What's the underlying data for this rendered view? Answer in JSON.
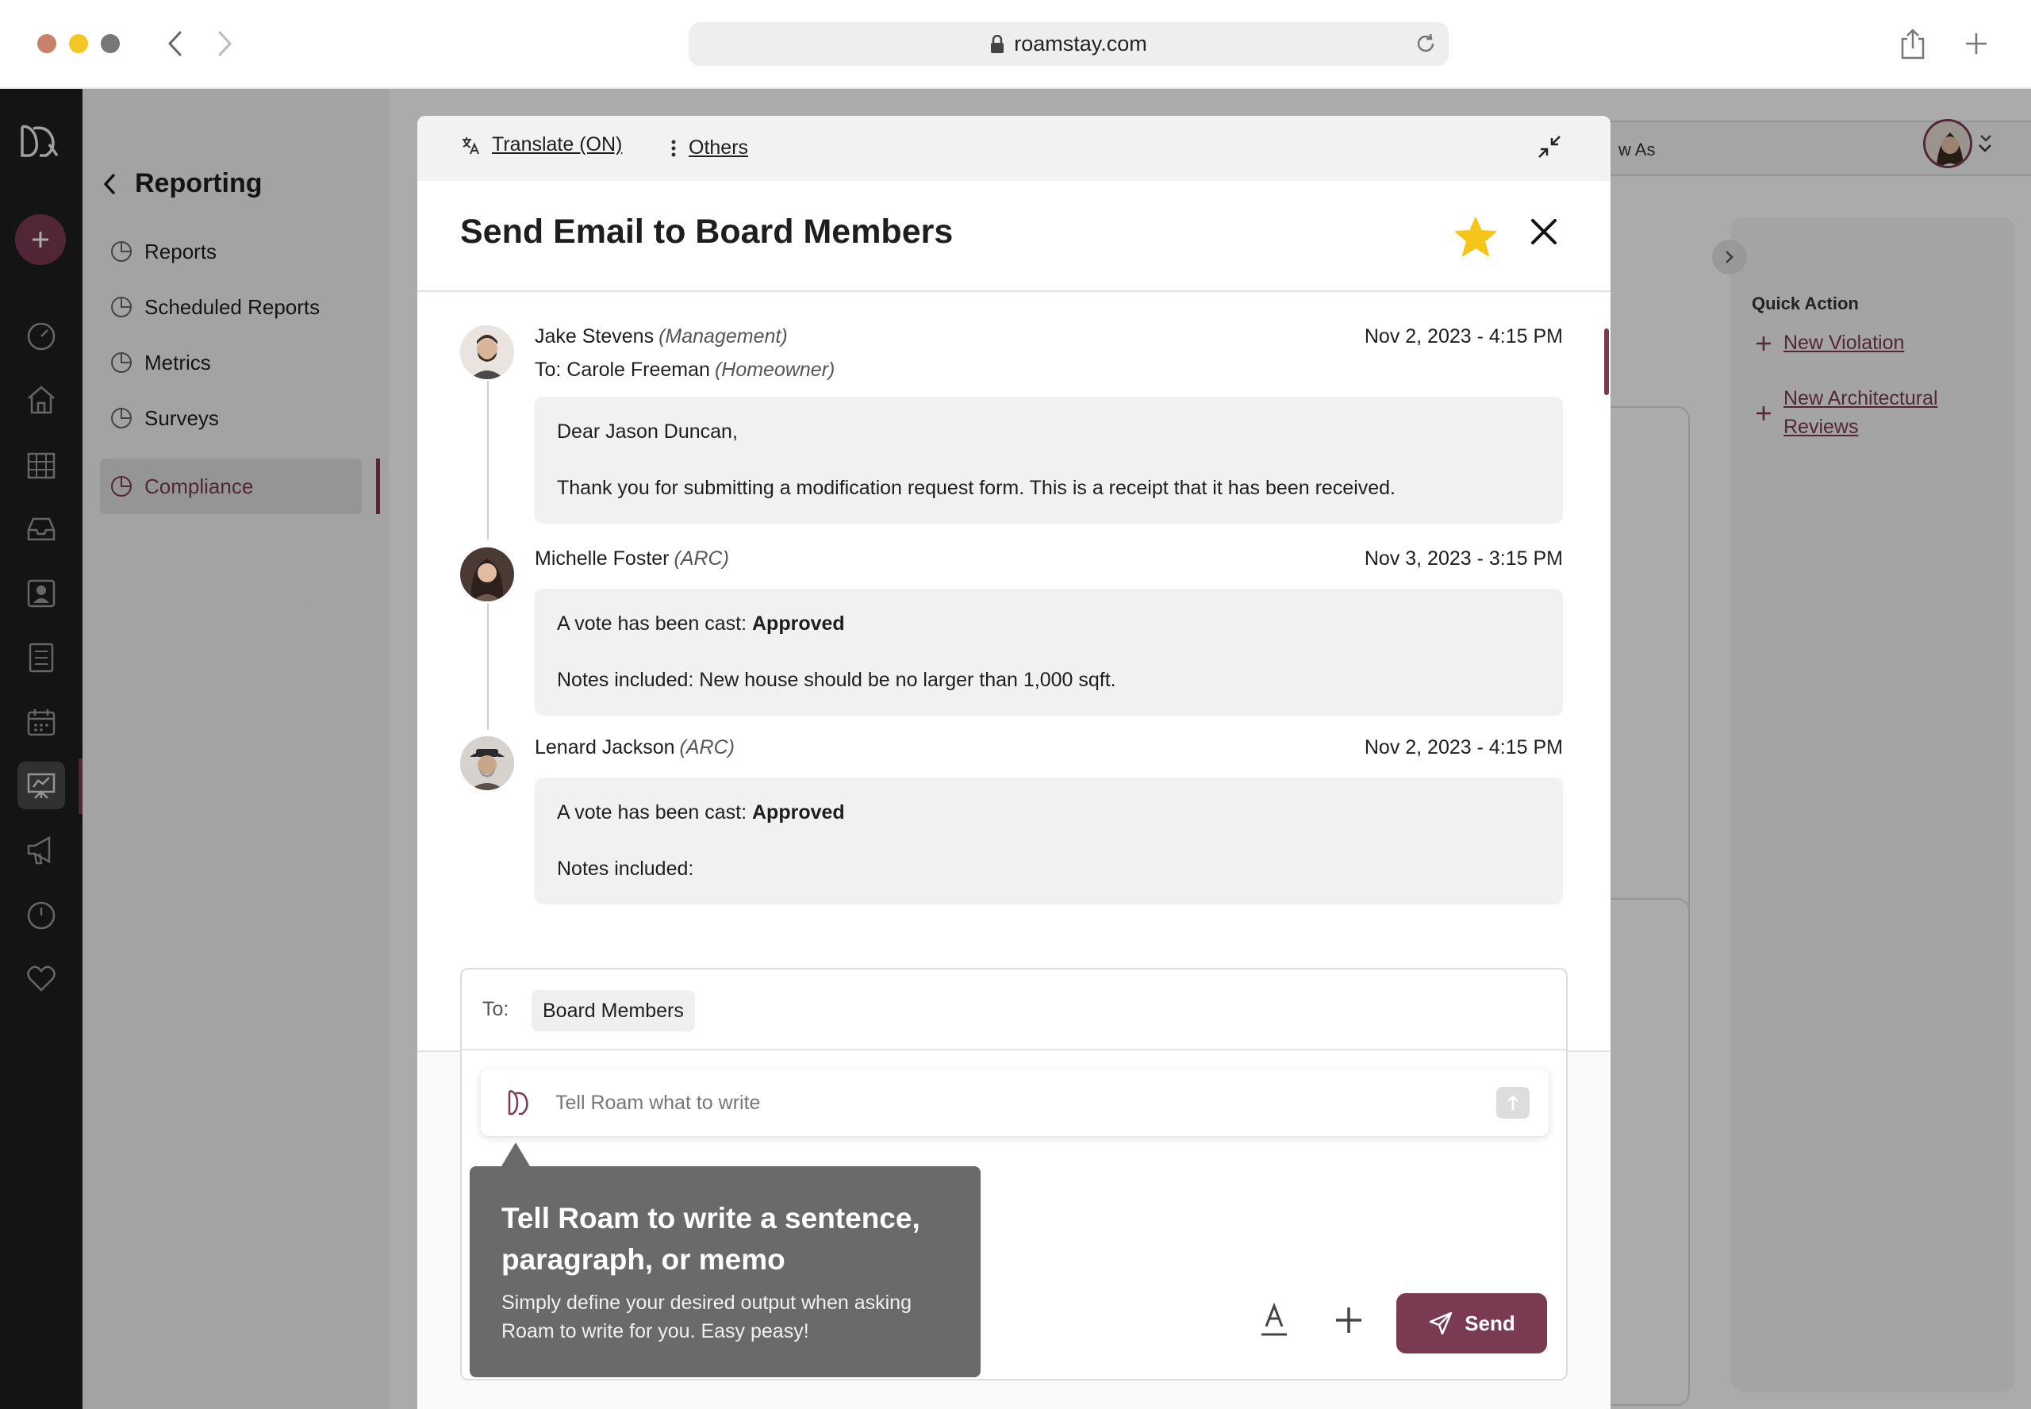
{
  "browser": {
    "url": "roamstay.com"
  },
  "sidebar": {
    "title": "Reporting",
    "items": [
      {
        "label": "Reports"
      },
      {
        "label": "Scheduled Reports"
      },
      {
        "label": "Metrics"
      },
      {
        "label": "Surveys"
      },
      {
        "label": "Compliance"
      }
    ]
  },
  "main": {
    "view_as_text": "w As",
    "quick_action": {
      "title": "Quick Action",
      "links": [
        "New Violation",
        "New Architectural",
        "Reviews"
      ]
    }
  },
  "modal": {
    "toolbar": {
      "translate_label": "Translate (ON)",
      "others_label": "Others"
    },
    "title": "Send Email to Board Members",
    "messages": [
      {
        "name": "Jake Stevens",
        "role": "(Management)",
        "date": "Nov 2, 2023 - 4:15 PM",
        "to_prefix": "To: Carole Freeman",
        "to_role": "(Homeowner)",
        "line1": "Dear Jason Duncan,",
        "line2": "Thank you for submitting a modification request form.  This is a receipt that it has been received."
      },
      {
        "name": "Michelle Foster",
        "role": "(ARC)",
        "date": "Nov 3, 2023 - 3:15 PM",
        "vote_prefix": "A vote has been cast: ",
        "vote_value": "Approved",
        "notes": "Notes included: New house should be no larger than 1,000 sqft."
      },
      {
        "name": "Lenard Jackson",
        "role": "(ARC)",
        "date": "Nov 2, 2023 - 4:15 PM",
        "vote_prefix": "A vote has been cast: ",
        "vote_value": "Approved",
        "notes": "Notes included:"
      }
    ],
    "compose": {
      "to_label": "To:",
      "recipient": "Board Members",
      "ai_placeholder": "Tell Roam what to write",
      "send_label": "Send"
    },
    "tooltip": {
      "title": "Tell Roam to write a sentence, paragraph, or memo",
      "body": "Simply define your desired output when asking Roam to write for you.  Easy peasy!"
    }
  },
  "colors": {
    "accent": "#7a3b52",
    "star": "#f6c519",
    "tooltip": "#6a6a6a"
  }
}
